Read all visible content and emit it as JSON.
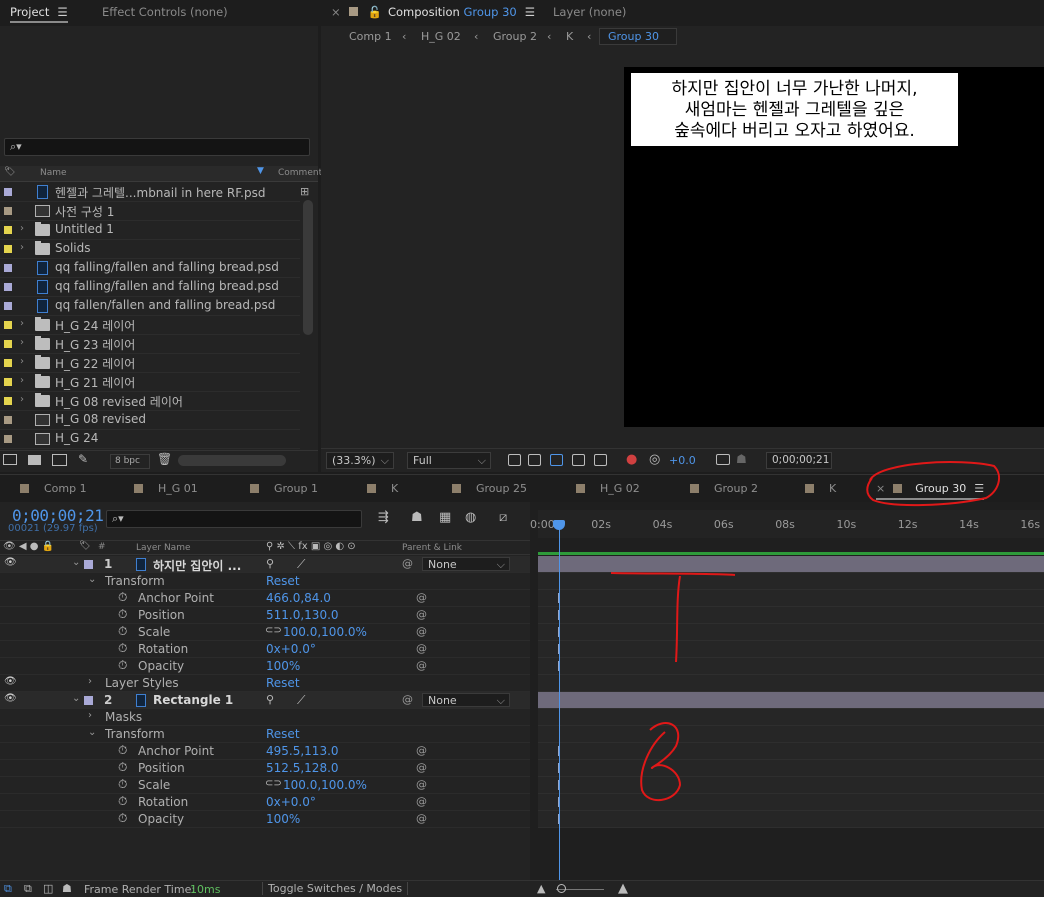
{
  "project_panel": {
    "tabs": [
      {
        "label": "Project"
      },
      {
        "label": "Effect Controls (none)"
      }
    ],
    "columns": {
      "name": "Name",
      "comment": "Comment"
    },
    "items": [
      {
        "label": "헨젤과 그레텔...mbnail in here RF.psd",
        "type": "psd",
        "color": "#a9a9d6",
        "expandable": false
      },
      {
        "label": "사전 구성 1",
        "type": "comp",
        "color": "#a89a84",
        "expandable": false
      },
      {
        "label": "Untitled 1",
        "type": "folder",
        "color": "#e4d44e",
        "expandable": true
      },
      {
        "label": "Solids",
        "type": "folder",
        "color": "#e4d44e",
        "expandable": true
      },
      {
        "label": "qq falling/fallen and falling bread.psd",
        "type": "psd",
        "color": "#a9a9d6",
        "expandable": false
      },
      {
        "label": "qq falling/fallen and falling bread.psd",
        "type": "psd",
        "color": "#a9a9d6",
        "expandable": false
      },
      {
        "label": "qq fallen/fallen and falling bread.psd",
        "type": "psd",
        "color": "#a9a9d6",
        "expandable": false
      },
      {
        "label": "H_G 24 레이어",
        "type": "folder",
        "color": "#e4d44e",
        "expandable": true
      },
      {
        "label": "H_G 23 레이어",
        "type": "folder",
        "color": "#e4d44e",
        "expandable": true
      },
      {
        "label": "H_G 22 레이어",
        "type": "folder",
        "color": "#e4d44e",
        "expandable": true
      },
      {
        "label": "H_G 21 레이어",
        "type": "folder",
        "color": "#e4d44e",
        "expandable": true
      },
      {
        "label": "H_G 08 revised 레이어",
        "type": "folder",
        "color": "#e4d44e",
        "expandable": true
      },
      {
        "label": "H_G 08 revised",
        "type": "comp",
        "color": "#a89a84",
        "expandable": false
      },
      {
        "label": "H_G 24",
        "type": "comp",
        "color": "#a89a84",
        "expandable": false
      }
    ],
    "bit_depth": "8 bpc"
  },
  "composition_panel": {
    "tab_prefix": "Composition",
    "tab_name": "Group 30",
    "layer_tab": "Layer (none)",
    "breadcrumbs": [
      "Comp 1",
      "H_G 02",
      "Group 2",
      "K",
      "Group 30"
    ],
    "caption_lines": [
      "하지만 집안이 너무 가난한 나머지,",
      "새엄마는 헨젤과 그레텔을 깊은",
      "숲속에다 버리고 오자고 하였어요."
    ],
    "zoom": "(33.3%)",
    "resolution": "Full",
    "exposure": "+0.0",
    "timecode": "0;00;00;21"
  },
  "timeline": {
    "tabs": [
      "Comp 1",
      "H_G 01",
      "Group 1",
      "K",
      "Group 25",
      "H_G 02",
      "Group 2",
      "K",
      "Group 30"
    ],
    "active_tab": "Group 30",
    "timecode": "0;00;00;21",
    "frames": "00021 (29.97 fps)",
    "columns": {
      "layer_name": "Layer Name",
      "parent": "Parent & Link"
    },
    "ruler": [
      "0:00s",
      "02s",
      "04s",
      "06s",
      "08s",
      "10s",
      "12s",
      "14s",
      "16s"
    ],
    "layers": [
      {
        "num": "1",
        "name": "하지만 집안이 ...",
        "parent": "None",
        "transform": "Transform",
        "reset": "Reset",
        "props": [
          {
            "name": "Anchor Point",
            "value": "466.0,84.0"
          },
          {
            "name": "Position",
            "value": "511.0,130.0"
          },
          {
            "name": "Scale",
            "value": "100.0,100.0%"
          },
          {
            "name": "Rotation",
            "value": "0x+0.0°"
          },
          {
            "name": "Opacity",
            "value": "100%"
          }
        ],
        "extra": {
          "name": "Layer Styles",
          "value": "Reset"
        }
      },
      {
        "num": "2",
        "name": "Rectangle 1",
        "parent": "None",
        "masks": "Masks",
        "transform": "Transform",
        "reset": "Reset",
        "props": [
          {
            "name": "Anchor Point",
            "value": "495.5,113.0"
          },
          {
            "name": "Position",
            "value": "512.5,128.0"
          },
          {
            "name": "Scale",
            "value": "100.0,100.0%"
          },
          {
            "name": "Rotation",
            "value": "0x+0.0°"
          },
          {
            "name": "Opacity",
            "value": "100%"
          }
        ]
      }
    ],
    "footer": {
      "render_label": "Frame Render Time:",
      "render_value": "10ms",
      "toggle": "Toggle Switches / Modes"
    }
  },
  "colors": {
    "accent": "#4f95e8",
    "annotation": "#e01818",
    "layer_bar": "#6e6a7b",
    "work_area": "#2e9b3a"
  }
}
